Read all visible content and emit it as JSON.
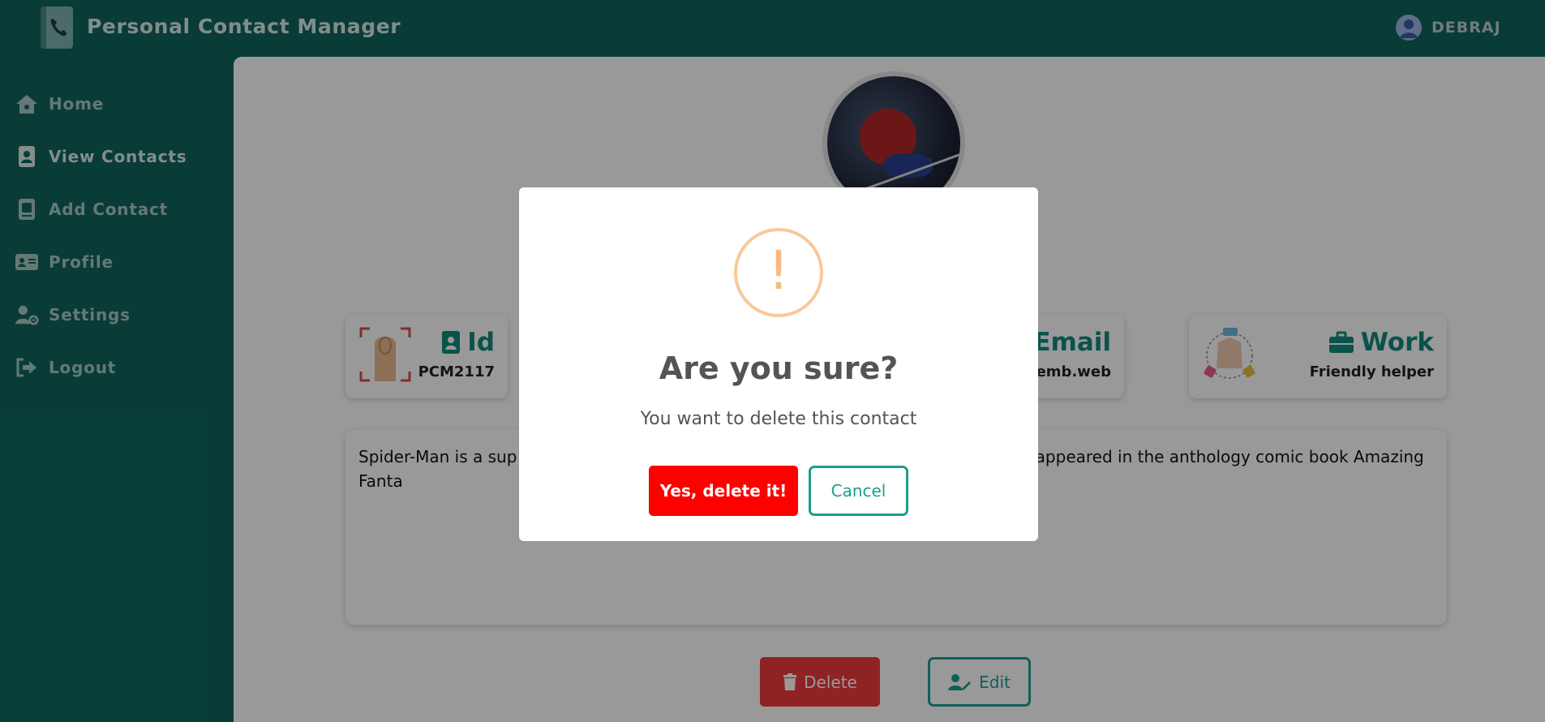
{
  "app": {
    "title": "Personal Contact Manager",
    "user_name": "DEBRAJ"
  },
  "sidebar": {
    "items": [
      {
        "label": "Home",
        "icon": "house-icon"
      },
      {
        "label": "View Contacts",
        "icon": "contact-book-icon",
        "active": true
      },
      {
        "label": "Add Contact",
        "icon": "add-contact-icon"
      },
      {
        "label": "Profile",
        "icon": "id-card-icon"
      },
      {
        "label": "Settings",
        "icon": "user-gear-icon"
      },
      {
        "label": "Logout",
        "icon": "logout-icon"
      }
    ]
  },
  "contact": {
    "id_title": "Id",
    "id_value": "PCM2117",
    "email_title": "@ Email",
    "email_value": "all@cliemb.web",
    "work_title": "Work",
    "work_value": "Friendly helper",
    "description": "Spider-Man is a sup                                                                              Ditko. He first appeared in the anthology comic book Amazing Fanta",
    "delete_label": "Delete",
    "edit_label": "Edit"
  },
  "dialog": {
    "icon": "!",
    "title": "Are you sure?",
    "text": "You want to delete this contact",
    "confirm_label": "Yes, delete it!",
    "cancel_label": "Cancel"
  },
  "colors": {
    "brand": "#0f655d",
    "accent": "#1a9e8f",
    "danger": "#ff0000",
    "warning": "#f8c99b"
  }
}
